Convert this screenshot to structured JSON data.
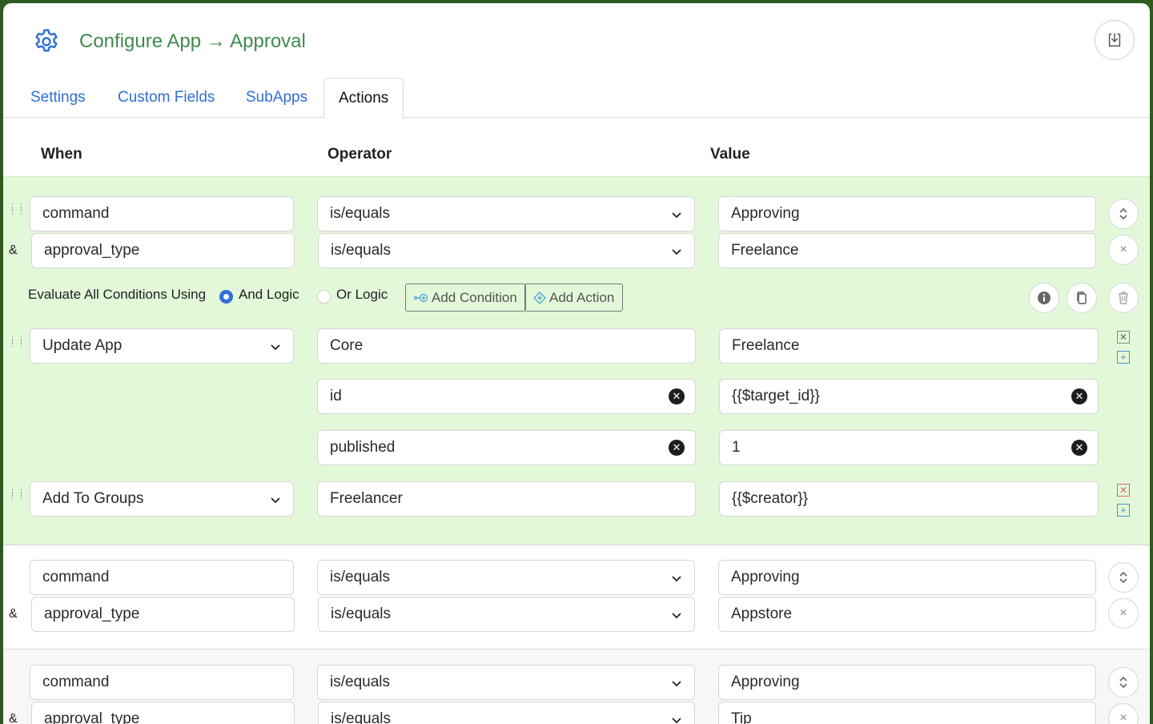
{
  "header": {
    "title": "Configure App → Approval",
    "gear_icon": "gear-icon",
    "download_icon": "download-icon"
  },
  "tabs": [
    {
      "label": "Settings",
      "active": false
    },
    {
      "label": "Custom Fields",
      "active": false
    },
    {
      "label": "SubApps",
      "active": false
    },
    {
      "label": "Actions",
      "active": true
    }
  ],
  "columns": {
    "when": "When",
    "operator": "Operator",
    "value": "Value"
  },
  "rules": [
    {
      "conditions": [
        {
          "field": "command",
          "operator": "is/equals",
          "value": "Approving"
        },
        {
          "joiner": "&",
          "field": "approval_type",
          "operator": "is/equals",
          "value": "Freelance"
        }
      ],
      "evaluate_label": "Evaluate All Conditions Using",
      "logic_options": [
        {
          "label": "And Logic",
          "selected": true
        },
        {
          "label": "Or Logic",
          "selected": false
        }
      ],
      "add_condition_label": "Add Condition",
      "add_action_label": "Add Action",
      "actions": [
        {
          "type": "Update App",
          "target": "Core",
          "value": "Freelance",
          "params": [
            {
              "key": "id",
              "value": "{{$target_id}}"
            },
            {
              "key": "published",
              "value": "1"
            }
          ]
        },
        {
          "type": "Add To Groups",
          "target": "Freelancer",
          "value": "{{$creator}}"
        }
      ]
    },
    {
      "conditions": [
        {
          "field": "command",
          "operator": "is/equals",
          "value": "Approving"
        },
        {
          "joiner": "&",
          "field": "approval_type",
          "operator": "is/equals",
          "value": "Appstore"
        }
      ]
    },
    {
      "conditions": [
        {
          "field": "command",
          "operator": "is/equals",
          "value": "Approving"
        },
        {
          "joiner": "&",
          "field": "approval_type",
          "operator": "is/equals",
          "value": "Tip"
        }
      ]
    }
  ],
  "colors": {
    "accent": "#2f6fd6",
    "title_green": "#3e8a4c",
    "rule_bg": "#e3f8d9"
  }
}
